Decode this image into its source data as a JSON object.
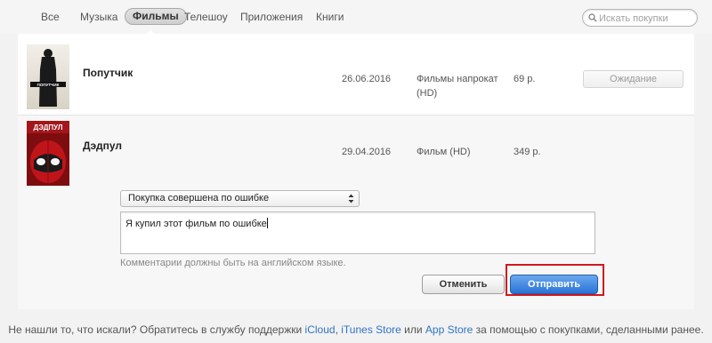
{
  "nav": {
    "tabs": [
      {
        "label": "Все"
      },
      {
        "label": "Музыка"
      },
      {
        "label": "Фильмы"
      },
      {
        "label": "Телешоу"
      },
      {
        "label": "Приложения"
      },
      {
        "label": "Книги"
      }
    ],
    "active_tab": "Фильмы",
    "search_placeholder": "Искать покупки"
  },
  "purchases": [
    {
      "title": "Попутчик",
      "poster_text": "ПОПУТЧИК",
      "date": "26.06.2016",
      "type_line1": "Фильмы напрокат",
      "type_line2": "(HD)",
      "price": "69 р.",
      "action_label": "Ожидание"
    },
    {
      "title": "Дэдпул",
      "poster_text": "ДЭДПУЛ",
      "date": "29.04.2016",
      "type_line1": "Фильм (HD)",
      "price": "349 р."
    }
  ],
  "report": {
    "reason_selected": "Покупка совершена по ошибке",
    "comment_value": "Я купил этот фильм по ошибке",
    "hint": "Комментарии должны быть на английском языке.",
    "cancel_label": "Отменить",
    "submit_label": "Отправить"
  },
  "footer": {
    "text_before": "Не нашли то, что искали? Обратитесь в службу поддержки ",
    "link_icloud": "iCloud",
    "sep1": ", ",
    "link_itunes": "iTunes Store",
    "sep2": " или ",
    "link_appstore": "App Store",
    "text_after": " за помощью с покупками, сделанными ранее."
  },
  "colors": {
    "accent_blue": "#2a73d6",
    "highlight_red": "#d0181e",
    "link_blue": "#2f74c4"
  }
}
